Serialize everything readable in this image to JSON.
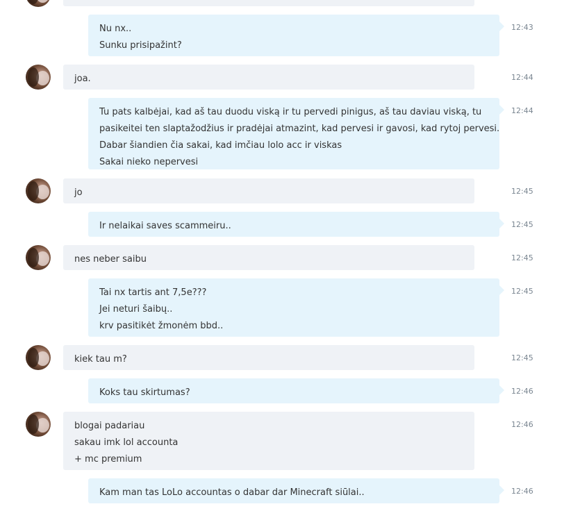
{
  "messages": [
    {
      "dir": "in",
      "avatar": true,
      "time": "",
      "lines": []
    },
    {
      "dir": "out",
      "avatar": false,
      "time": "12:43",
      "lines": [
        "Nu nx..",
        "Sunku prisipažint?"
      ]
    },
    {
      "dir": "in",
      "avatar": true,
      "time": "12:44",
      "lines": [
        "joa."
      ]
    },
    {
      "dir": "out",
      "avatar": false,
      "time": "12:44",
      "lines": [
        "Tu pats kalbėjai, kad aš tau duodu viską ir tu pervedi pinigus, aš tau daviau viską, tu",
        "pasikeitei ten slaptažodžius ir pradėjai atmazint, kad pervesi ir gavosi, kad rytoj pervesi.",
        "Dabar šiandien čia sakai, kad imčiau lolo acc ir viskas",
        "Sakai nieko nepervesi"
      ]
    },
    {
      "dir": "in",
      "avatar": true,
      "time": "12:45",
      "lines": [
        "jo"
      ]
    },
    {
      "dir": "out",
      "avatar": false,
      "time": "12:45",
      "lines": [
        "Ir nelaikai saves scammeiru.."
      ]
    },
    {
      "dir": "in",
      "avatar": true,
      "time": "12:45",
      "lines": [
        "nes neber saibu"
      ]
    },
    {
      "dir": "out",
      "avatar": false,
      "time": "12:45",
      "lines": [
        "Tai nx tartis ant 7,5e???",
        "Jei neturi šaibų..",
        "krv pasitikėt žmonėm bbd.."
      ]
    },
    {
      "dir": "in",
      "avatar": true,
      "time": "12:45",
      "lines": [
        "kiek tau  m?"
      ]
    },
    {
      "dir": "out",
      "avatar": false,
      "time": "12:46",
      "lines": [
        "Koks tau skirtumas?"
      ]
    },
    {
      "dir": "in",
      "avatar": true,
      "time": "12:46",
      "lines": [
        "blogai padariau",
        "sakau imk lol accounta",
        "+ mc premium"
      ]
    },
    {
      "dir": "out",
      "avatar": false,
      "time": "12:46",
      "lines": [
        "Kam man tas LoLo accountas o dabar dar Minecraft siūlai.."
      ]
    }
  ]
}
